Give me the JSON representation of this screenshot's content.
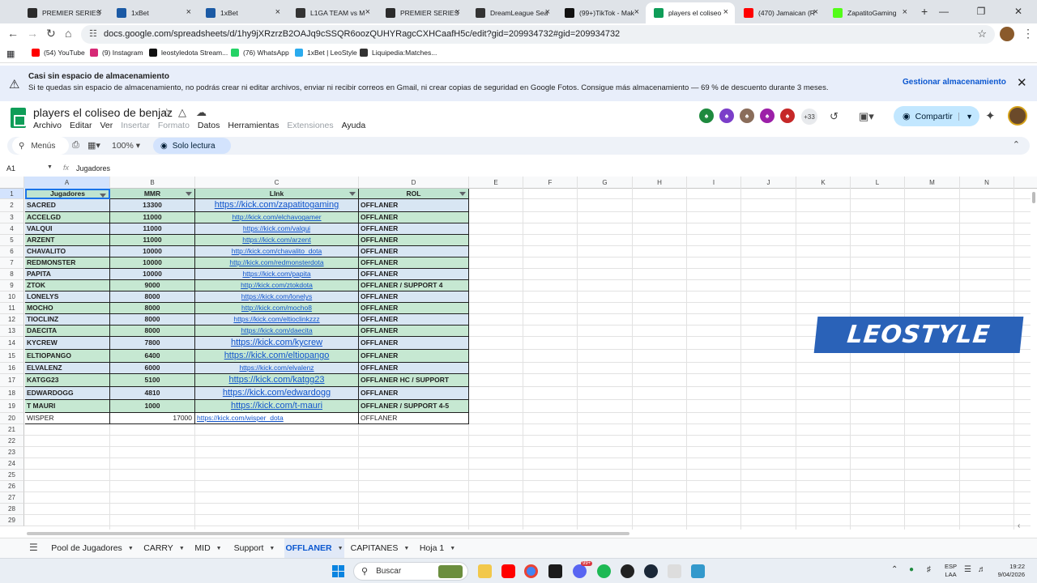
{
  "browser": {
    "tabs": [
      {
        "title": "PREMIER SERIES",
        "icon": "premier-series-icon",
        "color": "#2b2b2b"
      },
      {
        "title": "1xBet",
        "icon": "1xbet-icon",
        "color": "#1b5aa5"
      },
      {
        "title": "1xBet",
        "icon": "1xbet-icon",
        "color": "#1b5aa5"
      },
      {
        "title": "L1GA TEAM vs M",
        "icon": "pointer-icon",
        "color": "#333333"
      },
      {
        "title": "PREMIER SERIES",
        "icon": "premier-series-icon",
        "color": "#2b2b2b"
      },
      {
        "title": "DreamLeague Sea",
        "icon": "dreamleague-icon",
        "color": "#333333"
      },
      {
        "title": "(99+)TikTok - Mak",
        "icon": "tiktok-icon",
        "color": "#111111"
      },
      {
        "title": "players el coliseo",
        "icon": "sheets-icon",
        "color": "#0f9d58",
        "active": true
      },
      {
        "title": "(470) Jamaican (R",
        "icon": "youtube-icon",
        "color": "#ff0000"
      },
      {
        "title": "ZapatitoGaming",
        "icon": "kick-icon",
        "color": "#53fc18"
      }
    ],
    "new_tab": "+",
    "url": "docs.google.com/spreadsheets/d/1hy9jXRzrzB2OAJq9cSSQR6oozQUHYRagcCXHCaafH5c/edit?gid=209934732#gid=209934732",
    "bookmarks": [
      {
        "label": "(54) YouTube",
        "color": "#ff0000"
      },
      {
        "label": "(9) Instagram",
        "color": "#d62976"
      },
      {
        "label": "leostyledota Stream...",
        "color": "#111111"
      },
      {
        "label": "(76) WhatsApp",
        "color": "#25d366"
      },
      {
        "label": "1xBet | LeoStyle",
        "color": "#2aabee"
      },
      {
        "label": "Liquipedia:Matches...",
        "color": "#333333"
      }
    ]
  },
  "banner": {
    "title": "Casi sin espacio de almacenamiento",
    "text": "Si te quedas sin espacio de almacenamiento, no podrás crear ni editar archivos, enviar ni recibir correos en Gmail, ni crear copias de seguridad en Google Fotos. Consigue más almacenamiento — 69 % de descuento durante 3 meses.",
    "manage": "Gestionar almacenamiento"
  },
  "doc": {
    "title": "players el coliseo de benjaz",
    "menus": [
      {
        "label": "Archivo",
        "disabled": false
      },
      {
        "label": "Editar",
        "disabled": false
      },
      {
        "label": "Ver",
        "disabled": false
      },
      {
        "label": "Insertar",
        "disabled": true
      },
      {
        "label": "Formato",
        "disabled": true
      },
      {
        "label": "Datos",
        "disabled": false
      },
      {
        "label": "Herramientas",
        "disabled": false
      },
      {
        "label": "Extensiones",
        "disabled": true
      },
      {
        "label": "Ayuda",
        "disabled": false
      }
    ],
    "collaborators_extra": "+33",
    "share": "Compartir"
  },
  "toolbar": {
    "menus_search": "Menús",
    "zoom": "100%",
    "readonly": "Solo lectura"
  },
  "formula": {
    "cell_ref": "A1",
    "content": "Jugadores"
  },
  "sheet": {
    "columns": [
      "A",
      "B",
      "C",
      "D",
      "E",
      "F",
      "G",
      "H",
      "I",
      "J",
      "K",
      "L",
      "M",
      "N"
    ],
    "header": [
      "Jugadores",
      "MMR",
      "LInk",
      "ROL"
    ],
    "rows": [
      {
        "n": "2",
        "name": "SACRED",
        "mmr": "13300",
        "link": "https://kick.com/zapatitogaming",
        "rol": "OFFLANER",
        "big": true
      },
      {
        "n": "3",
        "name": "ACCELGD",
        "mmr": "11000",
        "link": "http://kick.com/elchavogamer",
        "rol": "OFFLANER"
      },
      {
        "n": "4",
        "name": "VALQUI",
        "mmr": "11000",
        "link": "https://kick.com/valqui",
        "rol": "OFFLANER"
      },
      {
        "n": "5",
        "name": "ARZENT",
        "mmr": "11000",
        "link": "https://kick.com/arzent",
        "rol": "OFFLANER"
      },
      {
        "n": "6",
        "name": "CHAVALITO",
        "mmr": "10000",
        "link": "http://kick.com/chavalito_dota",
        "rol": "OFFLANER"
      },
      {
        "n": "7",
        "name": "REDMONSTER",
        "mmr": "10000",
        "link": "http://kick.com/redmonsterdota",
        "rol": "OFFLANER"
      },
      {
        "n": "8",
        "name": "PAPITA",
        "mmr": "10000",
        "link": "https://kick.com/papita",
        "rol": "OFFLANER"
      },
      {
        "n": "9",
        "name": "ZTOK",
        "mmr": "9000",
        "link": "http://kick.com/ztokdota",
        "rol": "OFFLANER / SUPPORT 4"
      },
      {
        "n": "10",
        "name": "LONELYS",
        "mmr": "8000",
        "link": "https://kick.com/lonelys",
        "rol": "OFFLANER"
      },
      {
        "n": "11",
        "name": "MOCHO",
        "mmr": "8000",
        "link": "http://kick.com/mocho8",
        "rol": "OFFLANER"
      },
      {
        "n": "12",
        "name": "TIOCLINZ",
        "mmr": "8000",
        "link": "https://kick.com/eltioclinkzzz",
        "rol": "OFFLANER"
      },
      {
        "n": "13",
        "name": "DAECITA",
        "mmr": "8000",
        "link": "https://kick.com/daecita",
        "rol": "OFFLANER"
      },
      {
        "n": "14",
        "name": "KYCREW",
        "mmr": "7800",
        "link": "https://kick.com/kycrew",
        "rol": "OFFLANER",
        "big": true
      },
      {
        "n": "15",
        "name": "ELTIOPANGO",
        "mmr": "6400",
        "link": "https://kick.com/eltiopango",
        "rol": "OFFLANER",
        "big": true
      },
      {
        "n": "16",
        "name": "ELVALENZ",
        "mmr": "6000",
        "link": "https://kick.com/elvalenz",
        "rol": "OFFLANER"
      },
      {
        "n": "17",
        "name": "KATGG23",
        "mmr": "5100",
        "link": "https://kick.com/katgg23",
        "rol": "OFFLANER HC / SUPPORT",
        "big": true
      },
      {
        "n": "18",
        "name": "EDWARDOGG",
        "mmr": "4810",
        "link": "https://kick.com/edwardogg",
        "rol": "OFFLANER",
        "big": true
      },
      {
        "n": "19",
        "name": "T MAURI",
        "mmr": "1000",
        "link": "https://kick.com/t-mauri",
        "rol": "OFFLANER / SUPPORT 4-5",
        "big": true
      },
      {
        "n": "20",
        "name": "WISPER",
        "mmr": "17000",
        "link": "https://kick.com/wisper_dota",
        "rol": "OFFLANER",
        "plain": true
      }
    ],
    "empty_rows": [
      "21",
      "22",
      "23",
      "24",
      "25",
      "26",
      "27",
      "28",
      "29"
    ],
    "logo_text": "LEOSTYLE",
    "tabs": [
      {
        "label": "Pool de Jugadores"
      },
      {
        "label": "CARRY"
      },
      {
        "label": "MID"
      },
      {
        "label": "Support"
      },
      {
        "label": "OFFLANER",
        "active": true
      },
      {
        "label": "CAPITANES"
      },
      {
        "label": "Hoja 1"
      }
    ]
  },
  "taskbar": {
    "search": "Buscar",
    "lang_line1": "ESP",
    "lang_line2": "LAA",
    "time": "19:22",
    "date": "9/04/2026",
    "notif_badge": "99+"
  }
}
